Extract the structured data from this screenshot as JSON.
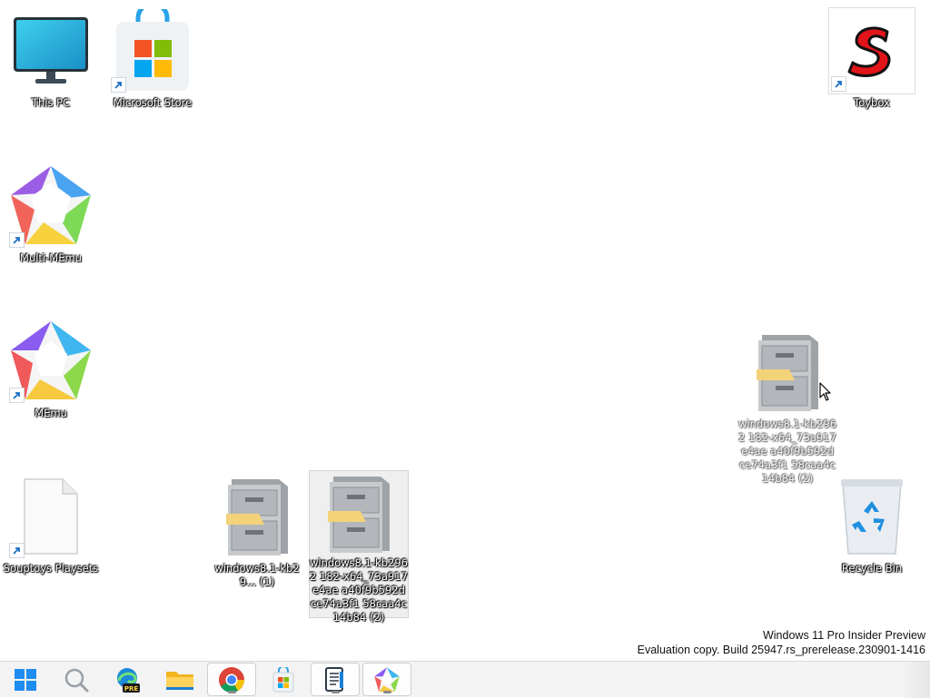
{
  "desktop": {
    "icons": [
      {
        "label": "This PC"
      },
      {
        "label": "Microsoft Store"
      },
      {
        "label": "Toybox"
      },
      {
        "label": "Multi-MEmu"
      },
      {
        "label": "MEmu"
      },
      {
        "label": "windows8.1-kb2962 182-x64_73a917e4ae a40f9b592dce74a3f1 58caa4c14b84 (2)"
      },
      {
        "label": "Souptoys Playsets"
      },
      {
        "label": "windows8.1-kb29... (1)"
      },
      {
        "label": "windows8.1-kb2962 182-x64_73a917e4ae a40f9b592dce74a3f1 58caa4c14b84 (2)"
      },
      {
        "label": "Recycle Bin"
      }
    ]
  },
  "watermark": {
    "line1": "Windows 11 Pro Insider Preview",
    "line2": "Evaluation copy. Build 25947.rs_prerelease.230901-1416"
  },
  "taskbar": {
    "items": [
      {
        "icon": "start-icon"
      },
      {
        "icon": "search-icon"
      },
      {
        "icon": "edge-preview-icon",
        "badge": "PRE"
      },
      {
        "icon": "file-explorer-icon"
      },
      {
        "icon": "chrome-icon"
      },
      {
        "icon": "microsoft-store-icon"
      },
      {
        "icon": "notepad-icon"
      },
      {
        "icon": "memu-icon"
      }
    ]
  },
  "colors": {
    "accent": "#0078d4",
    "taskbar": "#f3f3f3"
  }
}
